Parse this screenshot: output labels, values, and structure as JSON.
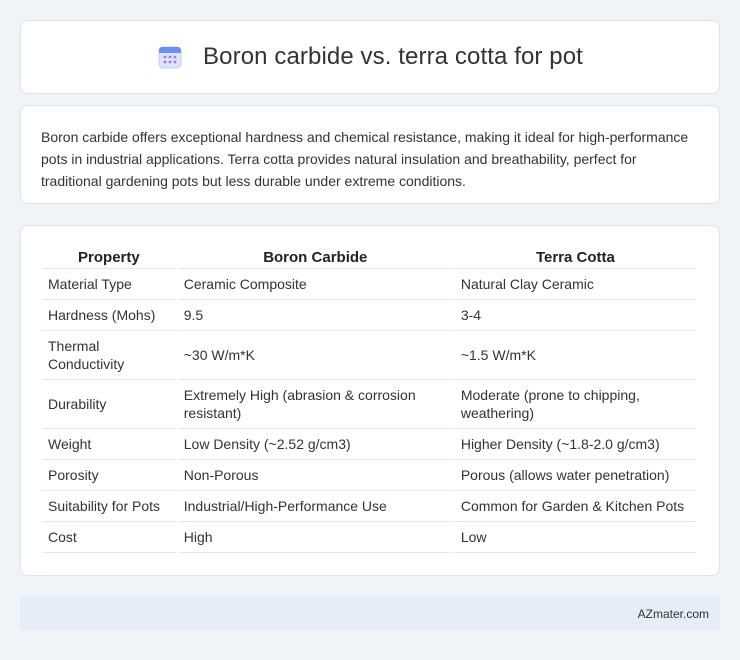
{
  "header": {
    "title": "Boron carbide vs. terra cotta for pot",
    "icon": "calendar-icon"
  },
  "intro": {
    "text": "Boron carbide offers exceptional hardness and chemical resistance, making it ideal for high-performance pots in industrial applications. Terra cotta provides natural insulation and breathability, perfect for traditional gardening pots but less durable under extreme conditions."
  },
  "table": {
    "headers": [
      "Property",
      "Boron Carbide",
      "Terra Cotta"
    ],
    "rows": [
      [
        "Material Type",
        "Ceramic Composite",
        "Natural Clay Ceramic"
      ],
      [
        "Hardness (Mohs)",
        "9.5",
        "3-4"
      ],
      [
        "Thermal Conductivity",
        "~30 W/m*K",
        "~1.5 W/m*K"
      ],
      [
        "Durability",
        "Extremely High (abrasion & corrosion resistant)",
        "Moderate (prone to chipping, weathering)"
      ],
      [
        "Weight",
        "Low Density (~2.52 g/cm3)",
        "Higher Density (~1.8-2.0 g/cm3)"
      ],
      [
        "Porosity",
        "Non-Porous",
        "Porous (allows water penetration)"
      ],
      [
        "Suitability for Pots",
        "Industrial/High-Performance Use",
        "Common for Garden & Kitchen Pots"
      ],
      [
        "Cost",
        "High",
        "Low"
      ]
    ]
  },
  "footer": {
    "text": "AZmater.com"
  }
}
